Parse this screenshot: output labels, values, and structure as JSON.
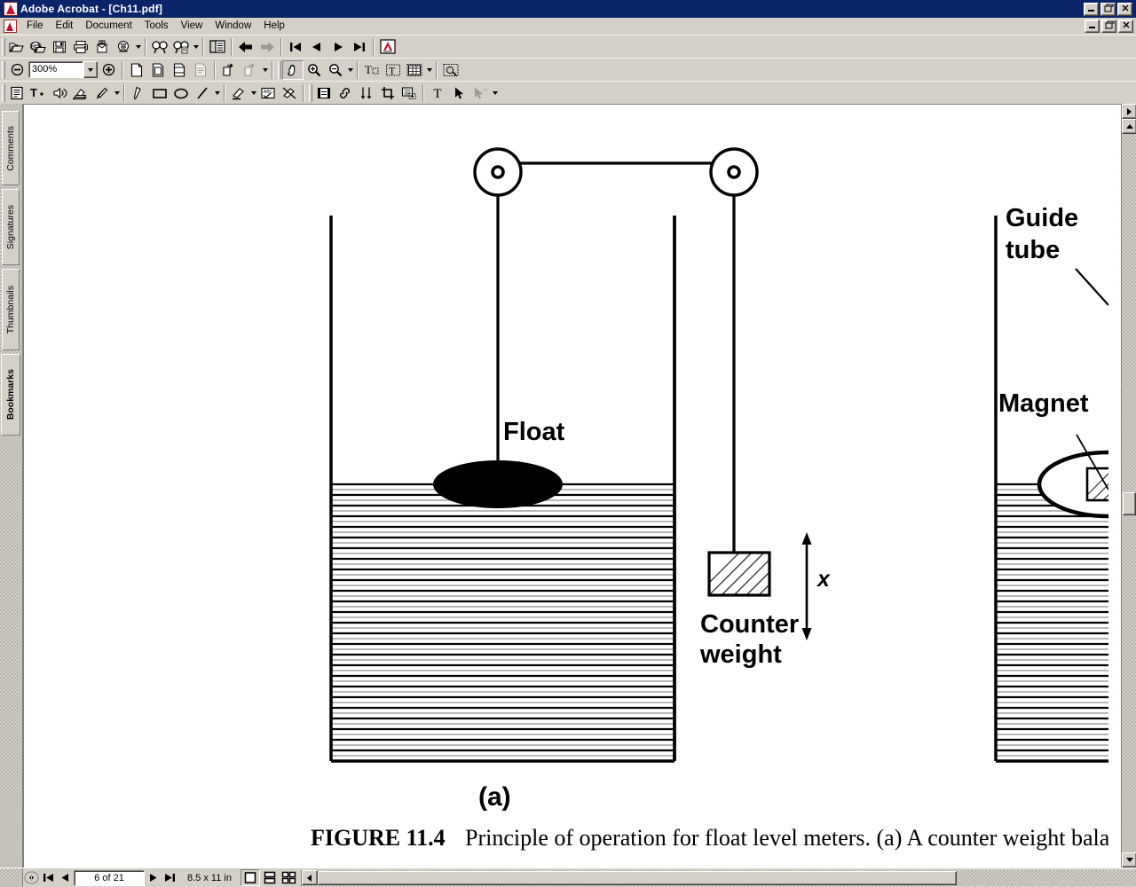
{
  "window": {
    "title": "Adobe Acrobat - [Ch11.pdf]",
    "app_icon": "acrobat-icon",
    "controls": [
      "minimize",
      "restore",
      "close"
    ],
    "mdi_controls": [
      "minimize",
      "restore",
      "close"
    ]
  },
  "menubar": {
    "items": [
      "File",
      "Edit",
      "Document",
      "Tools",
      "View",
      "Window",
      "Help"
    ]
  },
  "toolbar_file": {
    "buttons": [
      {
        "name": "open-file-icon",
        "title": "Open"
      },
      {
        "name": "open-web-page-icon",
        "title": "Open Web Page"
      },
      {
        "name": "save-icon",
        "title": "Save"
      },
      {
        "name": "print-icon",
        "title": "Print"
      },
      {
        "name": "email-icon",
        "title": "Email"
      },
      {
        "name": "batch-process-icon",
        "title": "Batch Process"
      },
      {
        "name": "find-icon",
        "title": "Find"
      },
      {
        "name": "search-icon",
        "title": "Search"
      },
      {
        "name": "show-hide-navigation-icon",
        "title": "Show/Hide Navigation Pane"
      },
      {
        "name": "previous-view-icon",
        "title": "Previous View"
      },
      {
        "name": "next-view-icon",
        "title": "Next View"
      },
      {
        "name": "first-page-icon",
        "title": "First Page"
      },
      {
        "name": "previous-page-icon",
        "title": "Previous Page"
      },
      {
        "name": "next-page-icon",
        "title": "Next Page"
      },
      {
        "name": "last-page-icon",
        "title": "Last Page"
      },
      {
        "name": "adobe-online-icon",
        "title": "Adobe Online"
      }
    ]
  },
  "toolbar_view": {
    "zoom_out_label": "zoom-out-icon",
    "zoom_value": "300%",
    "zoom_in_label": "zoom-in-icon",
    "buttons": [
      {
        "name": "actual-size-icon",
        "title": "Actual Size"
      },
      {
        "name": "fit-page-icon",
        "title": "Fit in Window"
      },
      {
        "name": "fit-width-icon",
        "title": "Fit Width"
      },
      {
        "name": "reflow-icon",
        "title": "Reflow"
      },
      {
        "name": "rotate-clockwise-icon",
        "title": "Rotate Clockwise"
      },
      {
        "name": "rotate-counterclockwise-icon",
        "title": "Rotate Counterclockwise"
      },
      {
        "name": "hand-tool-icon",
        "title": "Hand Tool"
      },
      {
        "name": "zoom-in-tool-icon",
        "title": "Zoom In Tool"
      },
      {
        "name": "zoom-out-tool-icon",
        "title": "Zoom Out Tool"
      },
      {
        "name": "text-select-tool-icon",
        "title": "Text Select Tool"
      },
      {
        "name": "column-select-tool-icon",
        "title": "Column Select Tool"
      },
      {
        "name": "table-select-tool-icon",
        "title": "Table/Formatted Text Select"
      },
      {
        "name": "snapshot-tool-icon",
        "title": "Snapshot Tool"
      }
    ]
  },
  "toolbar_comment": {
    "buttons": [
      {
        "name": "note-tool-icon",
        "title": "Note Tool"
      },
      {
        "name": "text-annotation-icon",
        "title": "Text Box Tool"
      },
      {
        "name": "sound-attachment-icon",
        "title": "Sound Attachment"
      },
      {
        "name": "stamp-tool-icon",
        "title": "Stamp Tool"
      },
      {
        "name": "file-attachment-icon",
        "title": "File Attachment"
      },
      {
        "name": "pencil-tool-icon",
        "title": "Pencil Tool"
      },
      {
        "name": "rectangle-tool-icon",
        "title": "Rectangle Tool"
      },
      {
        "name": "oval-tool-icon",
        "title": "Oval Tool"
      },
      {
        "name": "line-tool-icon",
        "title": "Line Tool"
      },
      {
        "name": "highlight-tool-icon",
        "title": "Highlighting Tool"
      },
      {
        "name": "spell-check-icon",
        "title": "Spell Check"
      },
      {
        "name": "erase-tool-icon",
        "title": "Erase Tool"
      },
      {
        "name": "movie-tool-icon",
        "title": "Movie Tool"
      },
      {
        "name": "link-tool-icon",
        "title": "Link Tool"
      },
      {
        "name": "digital-signature-icon",
        "title": "Digital Signature"
      },
      {
        "name": "crop-tool-icon",
        "title": "Crop Tool"
      },
      {
        "name": "form-tool-icon",
        "title": "Form Tool"
      },
      {
        "name": "touchup-text-icon",
        "title": "TouchUp Text Tool"
      },
      {
        "name": "touchup-object-icon",
        "title": "TouchUp Object Tool"
      },
      {
        "name": "touchup-order-icon",
        "title": "TouchUp Order Tool"
      }
    ]
  },
  "navigation_tabs": {
    "items": [
      {
        "label": "Comments",
        "active": false
      },
      {
        "label": "Signatures",
        "active": false
      },
      {
        "label": "Thumbnails",
        "active": false
      },
      {
        "label": "Bookmarks",
        "active": true
      }
    ]
  },
  "statusbar": {
    "first_page_icon": "first-page-icon",
    "prev_page_icon": "previous-page-icon",
    "page_indicator": "6 of 21",
    "next_page_icon": "next-page-icon",
    "last_page_icon": "last-page-icon",
    "page_size": "8.5 x 11 in",
    "view_buttons": [
      {
        "name": "single-page-view-icon",
        "active": true
      },
      {
        "name": "continuous-view-icon",
        "active": false
      },
      {
        "name": "continuous-facing-view-icon",
        "active": false
      }
    ]
  },
  "document": {
    "figure": {
      "caption_label": "FIGURE 11.4",
      "caption_text": "Principle of operation for float level meters. (a) A counter weight balan",
      "subfigure_label": "(a)",
      "labels": {
        "float": "Float",
        "counter_weight_line1": "Counter",
        "counter_weight_line2": "weight",
        "displacement": "x",
        "guide_tube_line1": "Guide",
        "guide_tube_line2": "tube",
        "magnet": "Magnet"
      },
      "colors": {
        "ink": "#000000",
        "paper": "#ffffff"
      }
    }
  }
}
